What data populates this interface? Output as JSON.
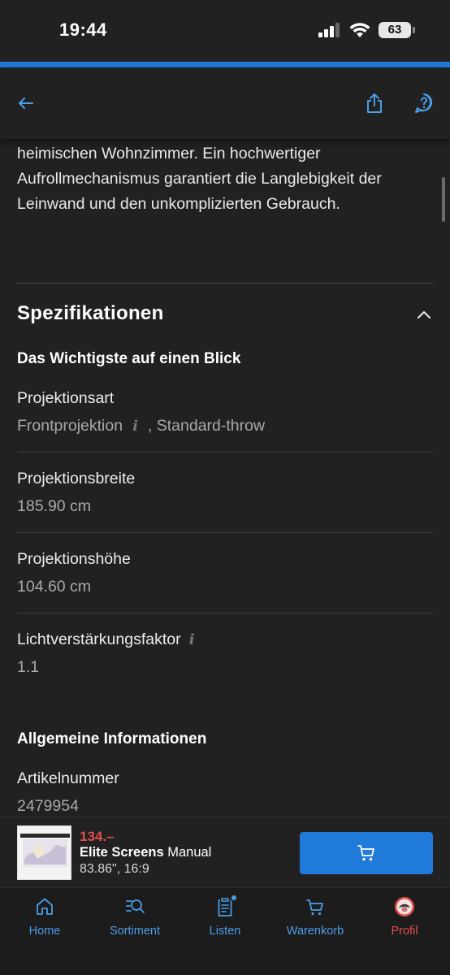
{
  "status_bar": {
    "time": "19:44",
    "battery": "63"
  },
  "nav": {
    "back_icon": "arrow-left-icon",
    "share_icon": "share-icon",
    "help_icon": "help-icon",
    "accent_color": "#1f7ad9"
  },
  "description": {
    "text": "heimischen Wohnzimmer. Ein hochwertiger Aufrollmechanismus garantiert die Langlebigkeit der Leinwand und den unkomplizierten Gebrauch."
  },
  "specs": {
    "title": "Spezifikationen",
    "group1_title": "Das Wichtigste auf einen Blick",
    "rows": [
      {
        "label": "Projektionsart",
        "value_a": "Frontprojektion",
        "value_b": ", Standard-throw"
      },
      {
        "label": "Projektionsbreite",
        "value": "185.90 cm"
      },
      {
        "label": "Projektionshöhe",
        "value": "104.60 cm"
      },
      {
        "label": "Lichtverstärkungsfaktor",
        "value": "1.1"
      }
    ],
    "group2_title": "Allgemeine Informationen",
    "general_rows": [
      {
        "label": "Artikelnummer",
        "value": "2479954"
      }
    ]
  },
  "product": {
    "price": "134.–",
    "brand": "Elite Screens",
    "name": " Manual",
    "meta": "83.86\", 16:9",
    "price_color": "#e44d4d"
  },
  "tabs": [
    {
      "label": "Home",
      "icon": "home-icon"
    },
    {
      "label": "Sortiment",
      "icon": "search-list-icon"
    },
    {
      "label": "Listen",
      "icon": "list-icon"
    },
    {
      "label": "Warenkorb",
      "icon": "cart-icon"
    },
    {
      "label": "Profil",
      "icon": "avatar-icon"
    }
  ]
}
